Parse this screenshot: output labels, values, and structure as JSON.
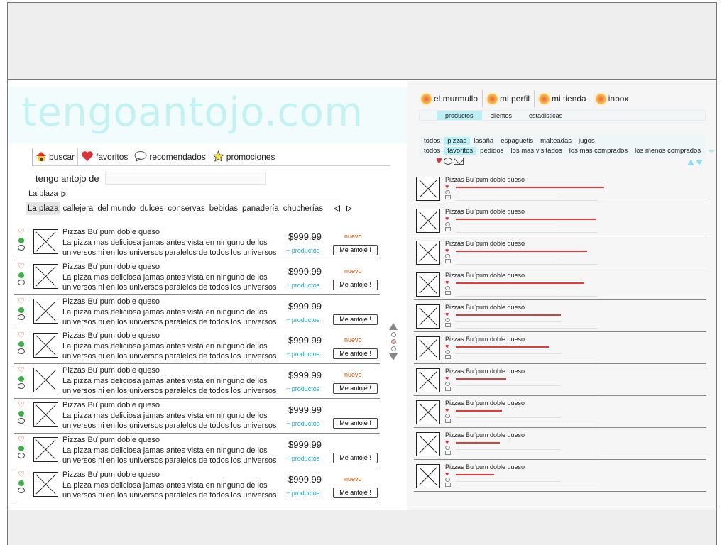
{
  "site": {
    "logo": "tengoantojo.com"
  },
  "left_nav": [
    {
      "label": "buscar",
      "icon": "house-icon"
    },
    {
      "label": "favoritos",
      "icon": "heart-icon"
    },
    {
      "label": "recomendados",
      "icon": "speech-bubble-icon"
    },
    {
      "label": "promociones",
      "icon": "star-icon"
    }
  ],
  "search": {
    "label": "tengo antojo de",
    "value": ""
  },
  "breadcrumb": {
    "label": "La plaza"
  },
  "categories": [
    "La plaza",
    "callejera",
    "del mundo",
    "dulces",
    "conservas",
    "bebidas",
    "panadería",
    "chucherías"
  ],
  "products": [
    {
      "title": "Pizzas Bu¨pum doble queso",
      "desc": "La pizza mas deliciosa jamas antes vista en ninguno de los universos ni en los universos paralelos de todos los universos",
      "price": "$999.99",
      "more": "+ productos",
      "badge": "nuevo",
      "button": "Me antojé !"
    },
    {
      "title": "Pizzas Bu¨pum doble queso",
      "desc": "La pizza mas deliciosa jamas antes vista en ninguno de los universos ni en los universos paralelos de todos los universos",
      "price": "$999.99",
      "more": "+ productos",
      "badge": "nuevo",
      "button": "Me antojé !"
    },
    {
      "title": "Pizzas Bu¨pum doble queso",
      "desc": "La pizza mas deliciosa jamas antes vista en ninguno de los universos ni en los universos paralelos de todos los universos",
      "price": "$999.99",
      "more": "+ productos",
      "badge": "",
      "button": "Me antojé !"
    },
    {
      "title": "Pizzas Bu¨pum doble queso",
      "desc": "La pizza mas deliciosa jamas antes vista en ninguno de los universos ni en los universos paralelos de todos los universos",
      "price": "$999.99",
      "more": "+ productos",
      "badge": "nuevo",
      "button": "Me antojé !"
    },
    {
      "title": "Pizzas Bu¨pum doble queso",
      "desc": "La pizza mas deliciosa jamas antes vista en ninguno de los universos ni en los universos paralelos de todos los universos",
      "price": "$999.99",
      "more": "+ productos",
      "badge": "nuevo",
      "button": "Me antojé !"
    },
    {
      "title": "Pizzas Bu¨pum doble queso",
      "desc": "La pizza mas deliciosa jamas antes vista en ninguno de los universos ni en los universos paralelos de todos los universos",
      "price": "$999.99",
      "more": "+ productos",
      "badge": "",
      "button": "Me antojé !"
    },
    {
      "title": "Pizzas Bu¨pum doble queso",
      "desc": "La pizza mas deliciosa jamas antes vista en ninguno de los universos ni en los universos paralelos de todos los universos",
      "price": "$999.99",
      "more": "+ productos",
      "badge": "",
      "button": "Me antojé !"
    },
    {
      "title": "Pizzas Bu¨pum doble queso",
      "desc": "La pizza mas deliciosa jamas antes vista en ninguno de los universos ni en los universos paralelos de todos los universos",
      "price": "$999.99",
      "more": "+ productos",
      "badge": "nuevo",
      "button": "Me antojé !"
    }
  ],
  "right_tabs": [
    {
      "label": "el murmullo",
      "icon": "sun-icon"
    },
    {
      "label": "mi perfil",
      "icon": "sun-icon"
    },
    {
      "label": "mi tienda",
      "icon": "sun-icon"
    },
    {
      "label": "inbox",
      "icon": "sun-icon"
    }
  ],
  "right_subtabs": [
    "productos",
    "clientes",
    "estadisticas"
  ],
  "filters_row1": [
    "todos",
    "pizzas",
    "lasaña",
    "espaguetis",
    "malteadas",
    "jugos"
  ],
  "filters_row2": [
    "todos",
    "favoritos",
    "pedidos",
    "los mas visitados",
    "los mas comprados",
    "los menos comprados"
  ],
  "right_products": [
    {
      "title": "Pizzas Bu¨pum doble queso",
      "score": 0.97
    },
    {
      "title": "Pizzas Bu¨pum doble queso",
      "score": 0.92
    },
    {
      "title": "Pizzas Bu¨pum doble queso",
      "score": 0.86
    },
    {
      "title": "Pizzas Bu¨pum doble queso",
      "score": 0.84
    },
    {
      "title": "Pizzas Bu¨pum doble queso",
      "score": 0.69
    },
    {
      "title": "Pizzas Bu¨pum doble queso",
      "score": 0.61
    },
    {
      "title": "Pizzas Bu¨pum doble queso",
      "score": 0.33
    },
    {
      "title": "Pizzas Bu¨pum doble queso",
      "score": 0.3
    },
    {
      "title": "Pizzas Bu¨pum doble queso",
      "score": 0.29
    },
    {
      "title": "Pizzas Bu¨pum doble queso",
      "score": 0.25
    }
  ],
  "colors": {
    "accent": "#b9f0f7",
    "heart": "#d9333a",
    "online": "#3cb043",
    "link": "#1aa7c7",
    "badge": "#d35400",
    "logo": "#c4f2f2"
  }
}
